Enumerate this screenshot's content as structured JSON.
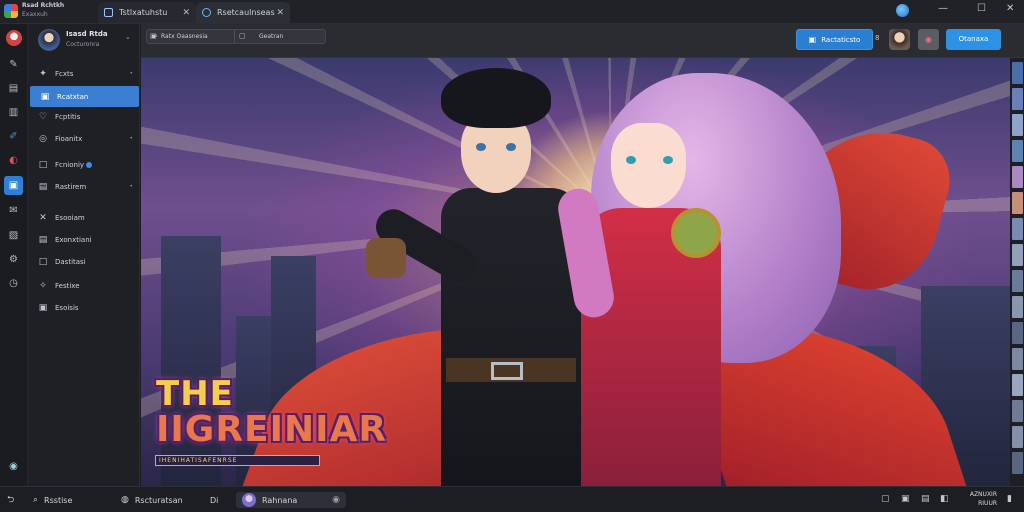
{
  "titlebar": {
    "app_name": "Rsad Rchtkh",
    "app_sub": "Exaxxuh",
    "tabs": [
      {
        "label": "Tstlxatuhstu"
      },
      {
        "label": "Rsetcaulnseas"
      }
    ],
    "close_glyph": "✕",
    "window_controls": {
      "minimize": "—",
      "maximize": "☐",
      "close": "✕"
    }
  },
  "sidebar": {
    "profile_name": "Isasd Rtda",
    "profile_sub": "Cocturonra",
    "groups": [
      [
        {
          "icon": "✦",
          "label": "Fcxts",
          "dot": "•"
        },
        {
          "icon": "▣",
          "label": "Rcatxtan",
          "active": true
        },
        {
          "icon": "♡",
          "label": "Fcptitis"
        },
        {
          "icon": "◎",
          "label": "Fioanitx",
          "dot": "•"
        }
      ],
      [
        {
          "icon": "□",
          "label": "Fcnioniy",
          "badge": true
        },
        {
          "icon": "▤",
          "label": "Rastirem",
          "dot": "•"
        }
      ],
      [
        {
          "icon": "✕",
          "label": "Esooiam"
        },
        {
          "icon": "▤",
          "label": "Exonxtiani"
        },
        {
          "icon": "□",
          "label": "Dastitasi"
        }
      ],
      [
        {
          "icon": "✧",
          "label": "Festixe"
        },
        {
          "icon": "▣",
          "label": "Esoisis"
        }
      ]
    ]
  },
  "toolbar": {
    "url_left": "Ratx Oaasnesia",
    "url_right": "Geatran",
    "primary_button": "Ractaticsto",
    "right_button": "Otanaxa",
    "mini": "8"
  },
  "artwork": {
    "title_line1": "THE",
    "title_line2": "IIGREINIAR",
    "title_sub": "IHENIHATISAFENRSE"
  },
  "taskbar": {
    "items": [
      {
        "label": "Rsstise"
      },
      {
        "label": "Rscturatsan"
      },
      {
        "label": "Rahnana"
      }
    ],
    "mid_label": "Di",
    "clock_line1": "AZNUXIR",
    "clock_line2": "RIUUR"
  }
}
